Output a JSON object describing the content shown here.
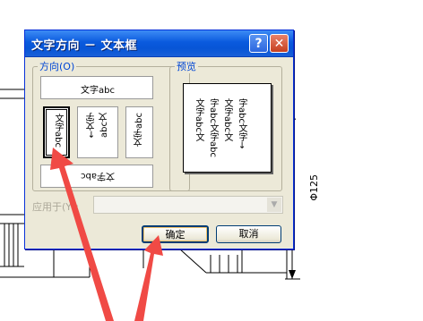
{
  "dialog": {
    "title": "文字方向 － 文本框",
    "help_label": "?",
    "close_label": "✕"
  },
  "orientation": {
    "group_label": "方向(O)",
    "horizontal_top": "文字abc",
    "vertical_1": "文字abc",
    "vertical_2_col1": "←文字",
    "vertical_2_col2": "abc文",
    "vertical_3": "文字abc",
    "horizontal_bottom": "文字abc"
  },
  "preview": {
    "group_label": "预览",
    "columns": [
      "文字abc文",
      "字abc文字abc",
      "文字abc文",
      "字abc文字→"
    ]
  },
  "apply_to": {
    "label": "应用于(Y):",
    "value": ""
  },
  "buttons": {
    "ok": "确定",
    "cancel": "取消"
  },
  "drawing": {
    "dimension_label": "Φ125"
  },
  "colors": {
    "accent": "#0a5ade",
    "arrow": "#f04a45"
  }
}
